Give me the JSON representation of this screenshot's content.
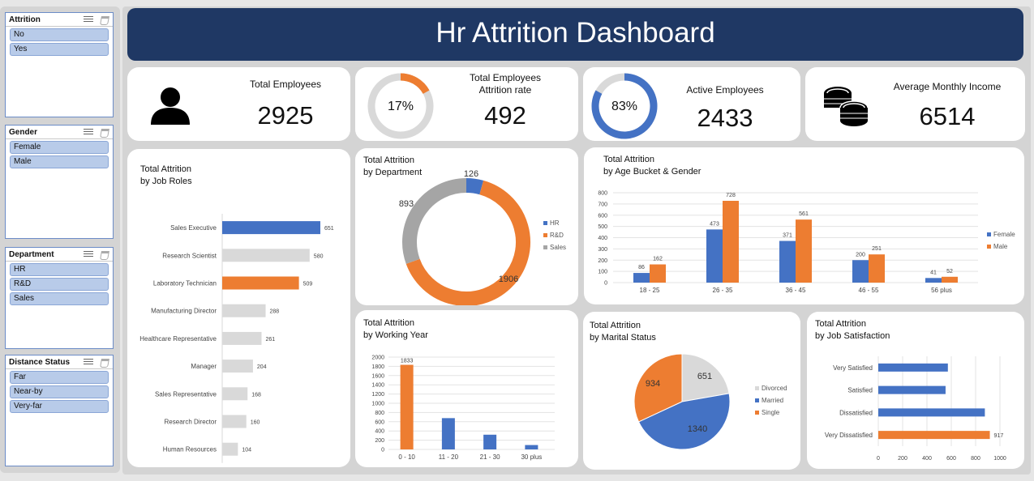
{
  "dashboard": {
    "title": "Hr Attrition Dashboard"
  },
  "colors": {
    "navy": "#1f3864",
    "blue": "#4472c4",
    "orange": "#ed7d31",
    "gray": "#d9d9d9",
    "darkgray": "#a5a5a5"
  },
  "slicers": [
    {
      "title": "Attrition",
      "items": [
        "No",
        "Yes"
      ]
    },
    {
      "title": "Gender",
      "items": [
        "Female",
        "Male"
      ]
    },
    {
      "title": "Department",
      "items": [
        "HR",
        "R&D",
        "Sales"
      ]
    },
    {
      "title": "Distance Status",
      "items": [
        "Far",
        "Near-by",
        "Very-far"
      ]
    }
  ],
  "kpis": {
    "total_employees": {
      "label": "Total Employees",
      "value": "2925",
      "icon": "person-icon"
    },
    "attrition": {
      "label_line1": "Total Employees",
      "label_line2": "Attrition rate",
      "value": "492",
      "rate_label": "17%",
      "rate": 0.17
    },
    "active": {
      "label": "Active Employees",
      "value": "2433",
      "rate_label": "83%",
      "rate": 0.83
    },
    "income": {
      "label": "Average Monthly Income",
      "value": "6514",
      "icon": "coins-icon"
    }
  },
  "chart_data": [
    {
      "id": "job_roles",
      "type": "bar",
      "orientation": "horizontal",
      "title": "Total Attrition",
      "subtitle": "by Job Roles",
      "categories": [
        "Sales Executive",
        "Research Scientist",
        "Laboratory Technician",
        "Manufacturing Director",
        "Healthcare Representative",
        "Manager",
        "Sales Representative",
        "Research Director",
        "Human Resources"
      ],
      "values": [
        651,
        580,
        509,
        288,
        261,
        204,
        168,
        160,
        104
      ],
      "highlight": {
        "0": "blue",
        "2": "orange"
      }
    },
    {
      "id": "department",
      "type": "pie",
      "variant": "donut",
      "title": "Total Attrition",
      "subtitle": "by Department",
      "categories": [
        "HR",
        "R&D",
        "Sales"
      ],
      "values": [
        126,
        1906,
        893
      ],
      "colors": [
        "#4472c4",
        "#ed7d31",
        "#a5a5a5"
      ],
      "legend": "right"
    },
    {
      "id": "age_gender",
      "type": "bar",
      "title": "Total Attrition",
      "subtitle": "by Age Bucket & Gender",
      "categories": [
        "18 - 25",
        "26 - 35",
        "36 - 45",
        "46 - 55",
        "56 plus"
      ],
      "series": [
        {
          "name": "Female",
          "values": [
            86,
            473,
            371,
            200,
            41
          ],
          "color": "#4472c4"
        },
        {
          "name": "Male",
          "values": [
            162,
            728,
            561,
            251,
            52
          ],
          "color": "#ed7d31"
        }
      ],
      "yticks": [
        "0",
        "100",
        "200",
        "300",
        "400",
        "500",
        "600",
        "700",
        "800"
      ],
      "ylim": [
        0,
        800
      ],
      "grid": true,
      "legend": "right"
    },
    {
      "id": "working_year",
      "type": "bar",
      "title": "Total Attrition",
      "subtitle": "by Working Year",
      "categories": [
        "0 - 10",
        "11 - 20",
        "21 - 30",
        "30 plus"
      ],
      "values": [
        1833,
        678,
        319,
        95
      ],
      "value_labels": [
        "1833",
        "",
        "",
        ""
      ],
      "colors": [
        "#ed7d31",
        "#4472c4",
        "#4472c4",
        "#4472c4"
      ],
      "yticks": [
        "0",
        "200",
        "400",
        "600",
        "800",
        "1000",
        "1200",
        "1400",
        "1600",
        "1800",
        "2000"
      ],
      "ylim": [
        0,
        2000
      ],
      "grid": true
    },
    {
      "id": "marital",
      "type": "pie",
      "title": "Total Attrition",
      "subtitle": "by Marital Status",
      "categories": [
        "Divorced",
        "Married",
        "Single"
      ],
      "values": [
        651,
        1340,
        934
      ],
      "colors": [
        "#d9d9d9",
        "#4472c4",
        "#ed7d31"
      ],
      "legend": "right"
    },
    {
      "id": "satisfaction",
      "type": "bar",
      "orientation": "horizontal",
      "title": "Total Attrition",
      "subtitle": "by Job Satisfaction",
      "categories": [
        "Very Satisfied",
        "Satisfied",
        "Dissatisfied",
        "Very Dissatisfied"
      ],
      "values": [
        572,
        553,
        876,
        917
      ],
      "value_labels": [
        "",
        "",
        "",
        "917"
      ],
      "colors": [
        "#4472c4",
        "#4472c4",
        "#4472c4",
        "#ed7d31"
      ],
      "xticks": [
        "0",
        "200",
        "400",
        "600",
        "800",
        "1000"
      ],
      "xlim": [
        0,
        1000
      ],
      "grid": true
    }
  ]
}
